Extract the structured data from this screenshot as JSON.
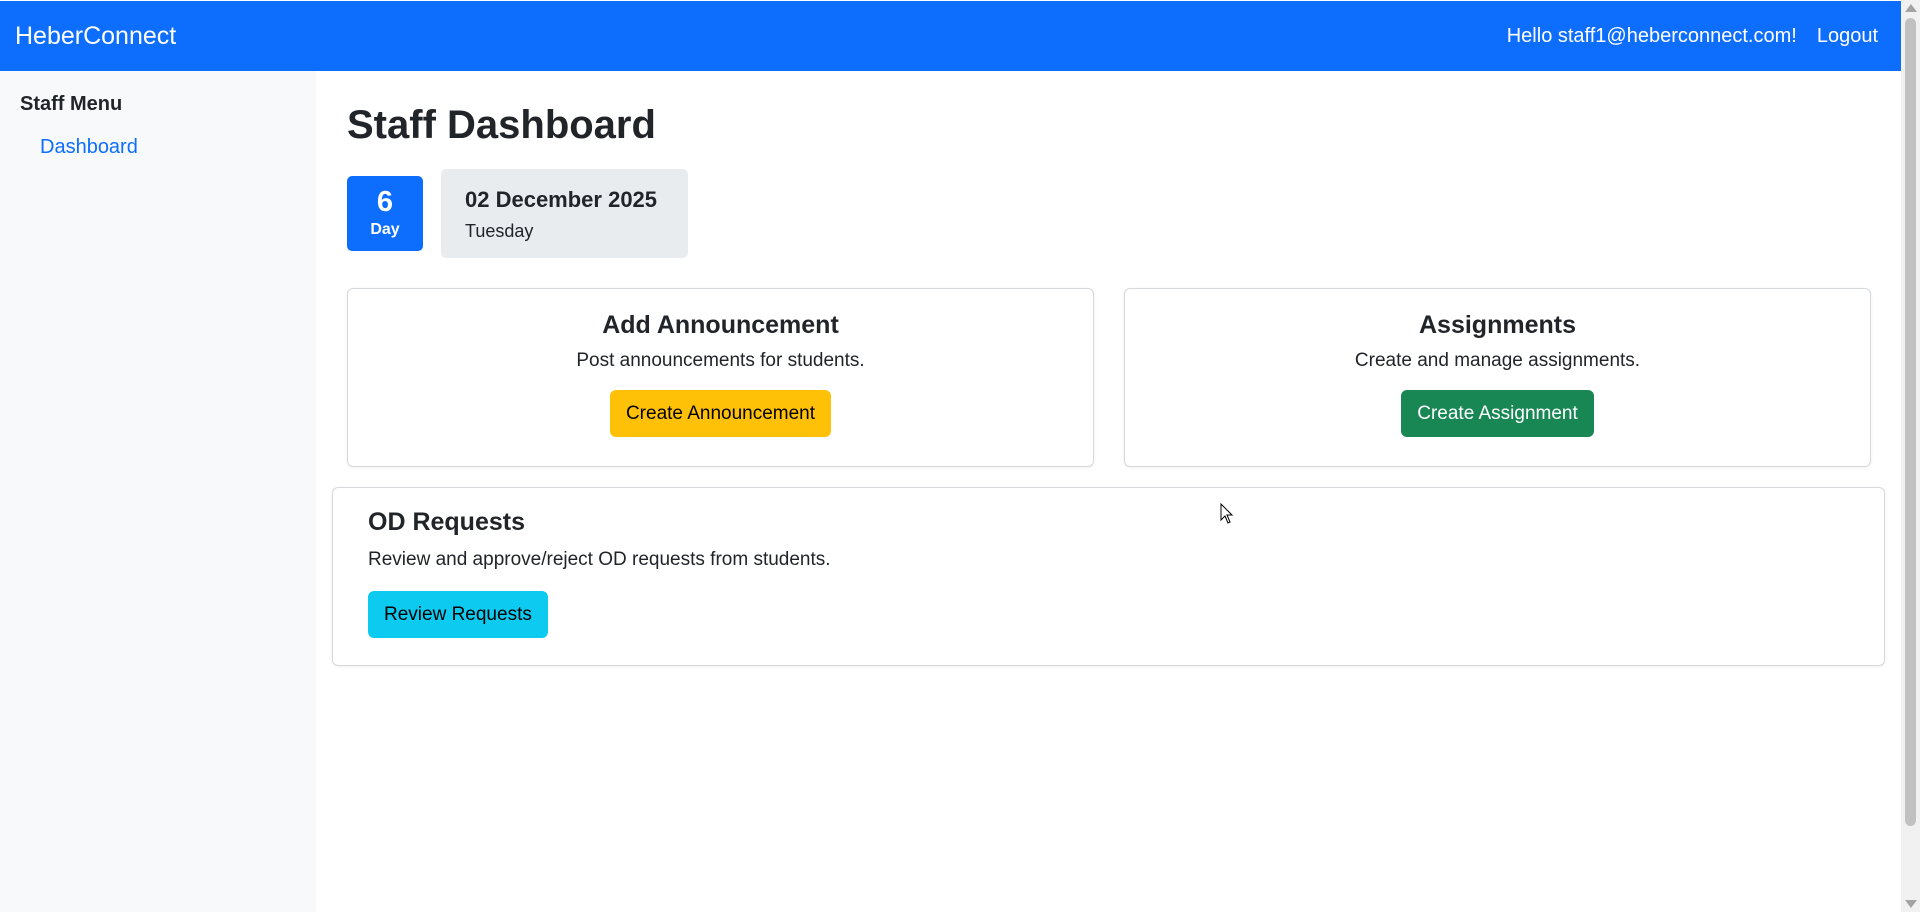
{
  "navbar": {
    "brand": "HeberConnect",
    "greeting": "Hello staff1@heberconnect.com!",
    "logout_label": "Logout"
  },
  "sidebar": {
    "title": "Staff Menu",
    "items": [
      {
        "label": "Dashboard"
      }
    ]
  },
  "main": {
    "title": "Staff Dashboard",
    "day": {
      "number": "6",
      "label": "Day"
    },
    "date": {
      "full": "02 December 2025",
      "weekday": "Tuesday"
    },
    "cards": {
      "announcement": {
        "title": "Add Announcement",
        "description": "Post announcements for students.",
        "button": "Create Announcement"
      },
      "assignments": {
        "title": "Assignments",
        "description": "Create and manage assignments.",
        "button": "Create Assignment"
      },
      "od_requests": {
        "title": "OD Requests",
        "description": "Review and approve/reject OD requests from students.",
        "button": "Review Requests"
      }
    }
  },
  "colors": {
    "primary": "#0d6efd",
    "warning": "#ffc107",
    "success": "#198754",
    "info": "#0dcaf0",
    "sidebar_bg": "#f8f9fa",
    "date_bg": "#e9ecef"
  }
}
